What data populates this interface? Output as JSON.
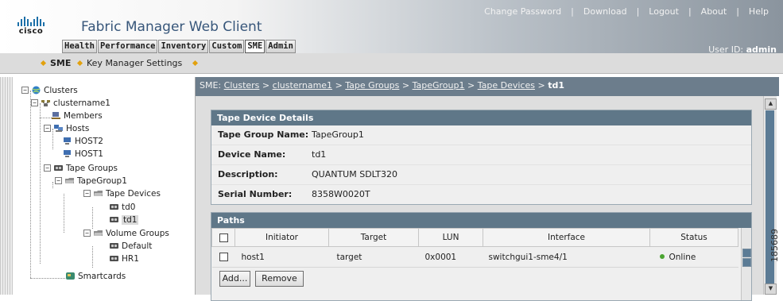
{
  "header": {
    "app_title": "Fabric Manager Web Client",
    "logo_text": "cisco",
    "tabs": [
      "Health",
      "Performance",
      "Inventory",
      "Custom",
      "SME",
      "Admin"
    ],
    "active_tab": "SME",
    "top_links": [
      "Change Password",
      "Download",
      "Logout",
      "About",
      "Help"
    ],
    "user_id_label": "User ID:",
    "user_id_value": "admin"
  },
  "submenu": {
    "items": [
      "SME",
      "Key Manager Settings"
    ]
  },
  "tree": {
    "nodes": [
      {
        "label": "Clusters",
        "icon": "globe-icon"
      },
      {
        "label": "clustername1",
        "icon": "cluster-icon"
      },
      {
        "label": "Members",
        "icon": "member-icon"
      },
      {
        "label": "Hosts",
        "icon": "hosts-icon"
      },
      {
        "label": "HOST2",
        "icon": "host-icon"
      },
      {
        "label": "HOST1",
        "icon": "host-icon"
      },
      {
        "label": "Tape Groups",
        "icon": "tape-group-icon"
      },
      {
        "label": "TapeGroup1",
        "icon": "tape-folder-icon"
      },
      {
        "label": "Tape Devices",
        "icon": "tape-folder-icon"
      },
      {
        "label": "td0",
        "icon": "tape-device-icon"
      },
      {
        "label": "td1",
        "icon": "tape-device-icon"
      },
      {
        "label": "Volume Groups",
        "icon": "tape-folder-icon"
      },
      {
        "label": "Default",
        "icon": "tape-device-icon"
      },
      {
        "label": "HR1",
        "icon": "tape-device-icon"
      },
      {
        "label": "Smartcards",
        "icon": "smartcard-icon"
      }
    ],
    "selected": "td1"
  },
  "breadcrumb": {
    "root": "SME:",
    "links": [
      "Clusters",
      "clustername1",
      "Tape Groups",
      "TapeGroup1",
      "Tape Devices"
    ],
    "separator": ">",
    "current": "td1"
  },
  "details": {
    "title": "Tape Device Details",
    "rows": [
      {
        "label": "Tape Group Name:",
        "value": "TapeGroup1"
      },
      {
        "label": "Device Name:",
        "value": "td1"
      },
      {
        "label": "Description:",
        "value": "QUANTUM SDLT320"
      },
      {
        "label": "Serial Number:",
        "value": "8358W0020T"
      }
    ]
  },
  "paths": {
    "title": "Paths",
    "columns": [
      "Initiator",
      "Target",
      "LUN",
      "Interface",
      "Status"
    ],
    "rows": [
      {
        "initiator": "host1",
        "target": "target",
        "lun": "0x0001",
        "interface": "switchgui1-sme4/1",
        "status": "Online"
      }
    ],
    "add_button": "Add...",
    "remove_button": "Remove"
  },
  "colors": {
    "breadcrumb_bg": "#6c7d8c",
    "panel_header_bg": "#5f7788",
    "status_online": "#4aa431",
    "submenu_diamond": "#e2a10e"
  },
  "figure_id": "185689"
}
